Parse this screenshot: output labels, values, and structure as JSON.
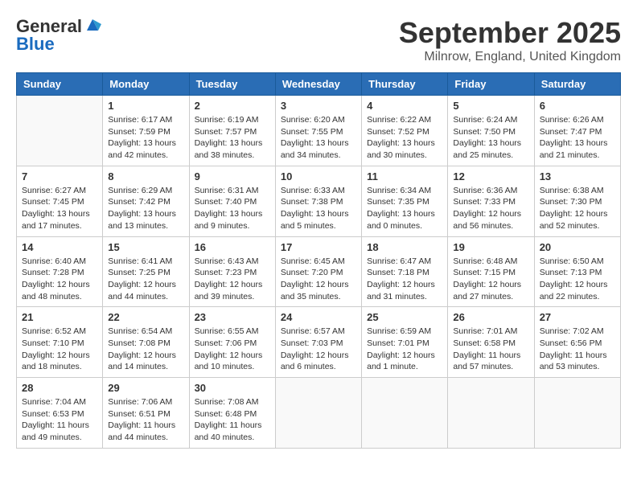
{
  "header": {
    "logo_general": "General",
    "logo_blue": "Blue",
    "month_title": "September 2025",
    "location": "Milnrow, England, United Kingdom"
  },
  "weekdays": [
    "Sunday",
    "Monday",
    "Tuesday",
    "Wednesday",
    "Thursday",
    "Friday",
    "Saturday"
  ],
  "weeks": [
    [
      {
        "day": "",
        "info": ""
      },
      {
        "day": "1",
        "info": "Sunrise: 6:17 AM\nSunset: 7:59 PM\nDaylight: 13 hours\nand 42 minutes."
      },
      {
        "day": "2",
        "info": "Sunrise: 6:19 AM\nSunset: 7:57 PM\nDaylight: 13 hours\nand 38 minutes."
      },
      {
        "day": "3",
        "info": "Sunrise: 6:20 AM\nSunset: 7:55 PM\nDaylight: 13 hours\nand 34 minutes."
      },
      {
        "day": "4",
        "info": "Sunrise: 6:22 AM\nSunset: 7:52 PM\nDaylight: 13 hours\nand 30 minutes."
      },
      {
        "day": "5",
        "info": "Sunrise: 6:24 AM\nSunset: 7:50 PM\nDaylight: 13 hours\nand 25 minutes."
      },
      {
        "day": "6",
        "info": "Sunrise: 6:26 AM\nSunset: 7:47 PM\nDaylight: 13 hours\nand 21 minutes."
      }
    ],
    [
      {
        "day": "7",
        "info": "Sunrise: 6:27 AM\nSunset: 7:45 PM\nDaylight: 13 hours\nand 17 minutes."
      },
      {
        "day": "8",
        "info": "Sunrise: 6:29 AM\nSunset: 7:42 PM\nDaylight: 13 hours\nand 13 minutes."
      },
      {
        "day": "9",
        "info": "Sunrise: 6:31 AM\nSunset: 7:40 PM\nDaylight: 13 hours\nand 9 minutes."
      },
      {
        "day": "10",
        "info": "Sunrise: 6:33 AM\nSunset: 7:38 PM\nDaylight: 13 hours\nand 5 minutes."
      },
      {
        "day": "11",
        "info": "Sunrise: 6:34 AM\nSunset: 7:35 PM\nDaylight: 13 hours\nand 0 minutes."
      },
      {
        "day": "12",
        "info": "Sunrise: 6:36 AM\nSunset: 7:33 PM\nDaylight: 12 hours\nand 56 minutes."
      },
      {
        "day": "13",
        "info": "Sunrise: 6:38 AM\nSunset: 7:30 PM\nDaylight: 12 hours\nand 52 minutes."
      }
    ],
    [
      {
        "day": "14",
        "info": "Sunrise: 6:40 AM\nSunset: 7:28 PM\nDaylight: 12 hours\nand 48 minutes."
      },
      {
        "day": "15",
        "info": "Sunrise: 6:41 AM\nSunset: 7:25 PM\nDaylight: 12 hours\nand 44 minutes."
      },
      {
        "day": "16",
        "info": "Sunrise: 6:43 AM\nSunset: 7:23 PM\nDaylight: 12 hours\nand 39 minutes."
      },
      {
        "day": "17",
        "info": "Sunrise: 6:45 AM\nSunset: 7:20 PM\nDaylight: 12 hours\nand 35 minutes."
      },
      {
        "day": "18",
        "info": "Sunrise: 6:47 AM\nSunset: 7:18 PM\nDaylight: 12 hours\nand 31 minutes."
      },
      {
        "day": "19",
        "info": "Sunrise: 6:48 AM\nSunset: 7:15 PM\nDaylight: 12 hours\nand 27 minutes."
      },
      {
        "day": "20",
        "info": "Sunrise: 6:50 AM\nSunset: 7:13 PM\nDaylight: 12 hours\nand 22 minutes."
      }
    ],
    [
      {
        "day": "21",
        "info": "Sunrise: 6:52 AM\nSunset: 7:10 PM\nDaylight: 12 hours\nand 18 minutes."
      },
      {
        "day": "22",
        "info": "Sunrise: 6:54 AM\nSunset: 7:08 PM\nDaylight: 12 hours\nand 14 minutes."
      },
      {
        "day": "23",
        "info": "Sunrise: 6:55 AM\nSunset: 7:06 PM\nDaylight: 12 hours\nand 10 minutes."
      },
      {
        "day": "24",
        "info": "Sunrise: 6:57 AM\nSunset: 7:03 PM\nDaylight: 12 hours\nand 6 minutes."
      },
      {
        "day": "25",
        "info": "Sunrise: 6:59 AM\nSunset: 7:01 PM\nDaylight: 12 hours\nand 1 minute."
      },
      {
        "day": "26",
        "info": "Sunrise: 7:01 AM\nSunset: 6:58 PM\nDaylight: 11 hours\nand 57 minutes."
      },
      {
        "day": "27",
        "info": "Sunrise: 7:02 AM\nSunset: 6:56 PM\nDaylight: 11 hours\nand 53 minutes."
      }
    ],
    [
      {
        "day": "28",
        "info": "Sunrise: 7:04 AM\nSunset: 6:53 PM\nDaylight: 11 hours\nand 49 minutes."
      },
      {
        "day": "29",
        "info": "Sunrise: 7:06 AM\nSunset: 6:51 PM\nDaylight: 11 hours\nand 44 minutes."
      },
      {
        "day": "30",
        "info": "Sunrise: 7:08 AM\nSunset: 6:48 PM\nDaylight: 11 hours\nand 40 minutes."
      },
      {
        "day": "",
        "info": ""
      },
      {
        "day": "",
        "info": ""
      },
      {
        "day": "",
        "info": ""
      },
      {
        "day": "",
        "info": ""
      }
    ]
  ]
}
